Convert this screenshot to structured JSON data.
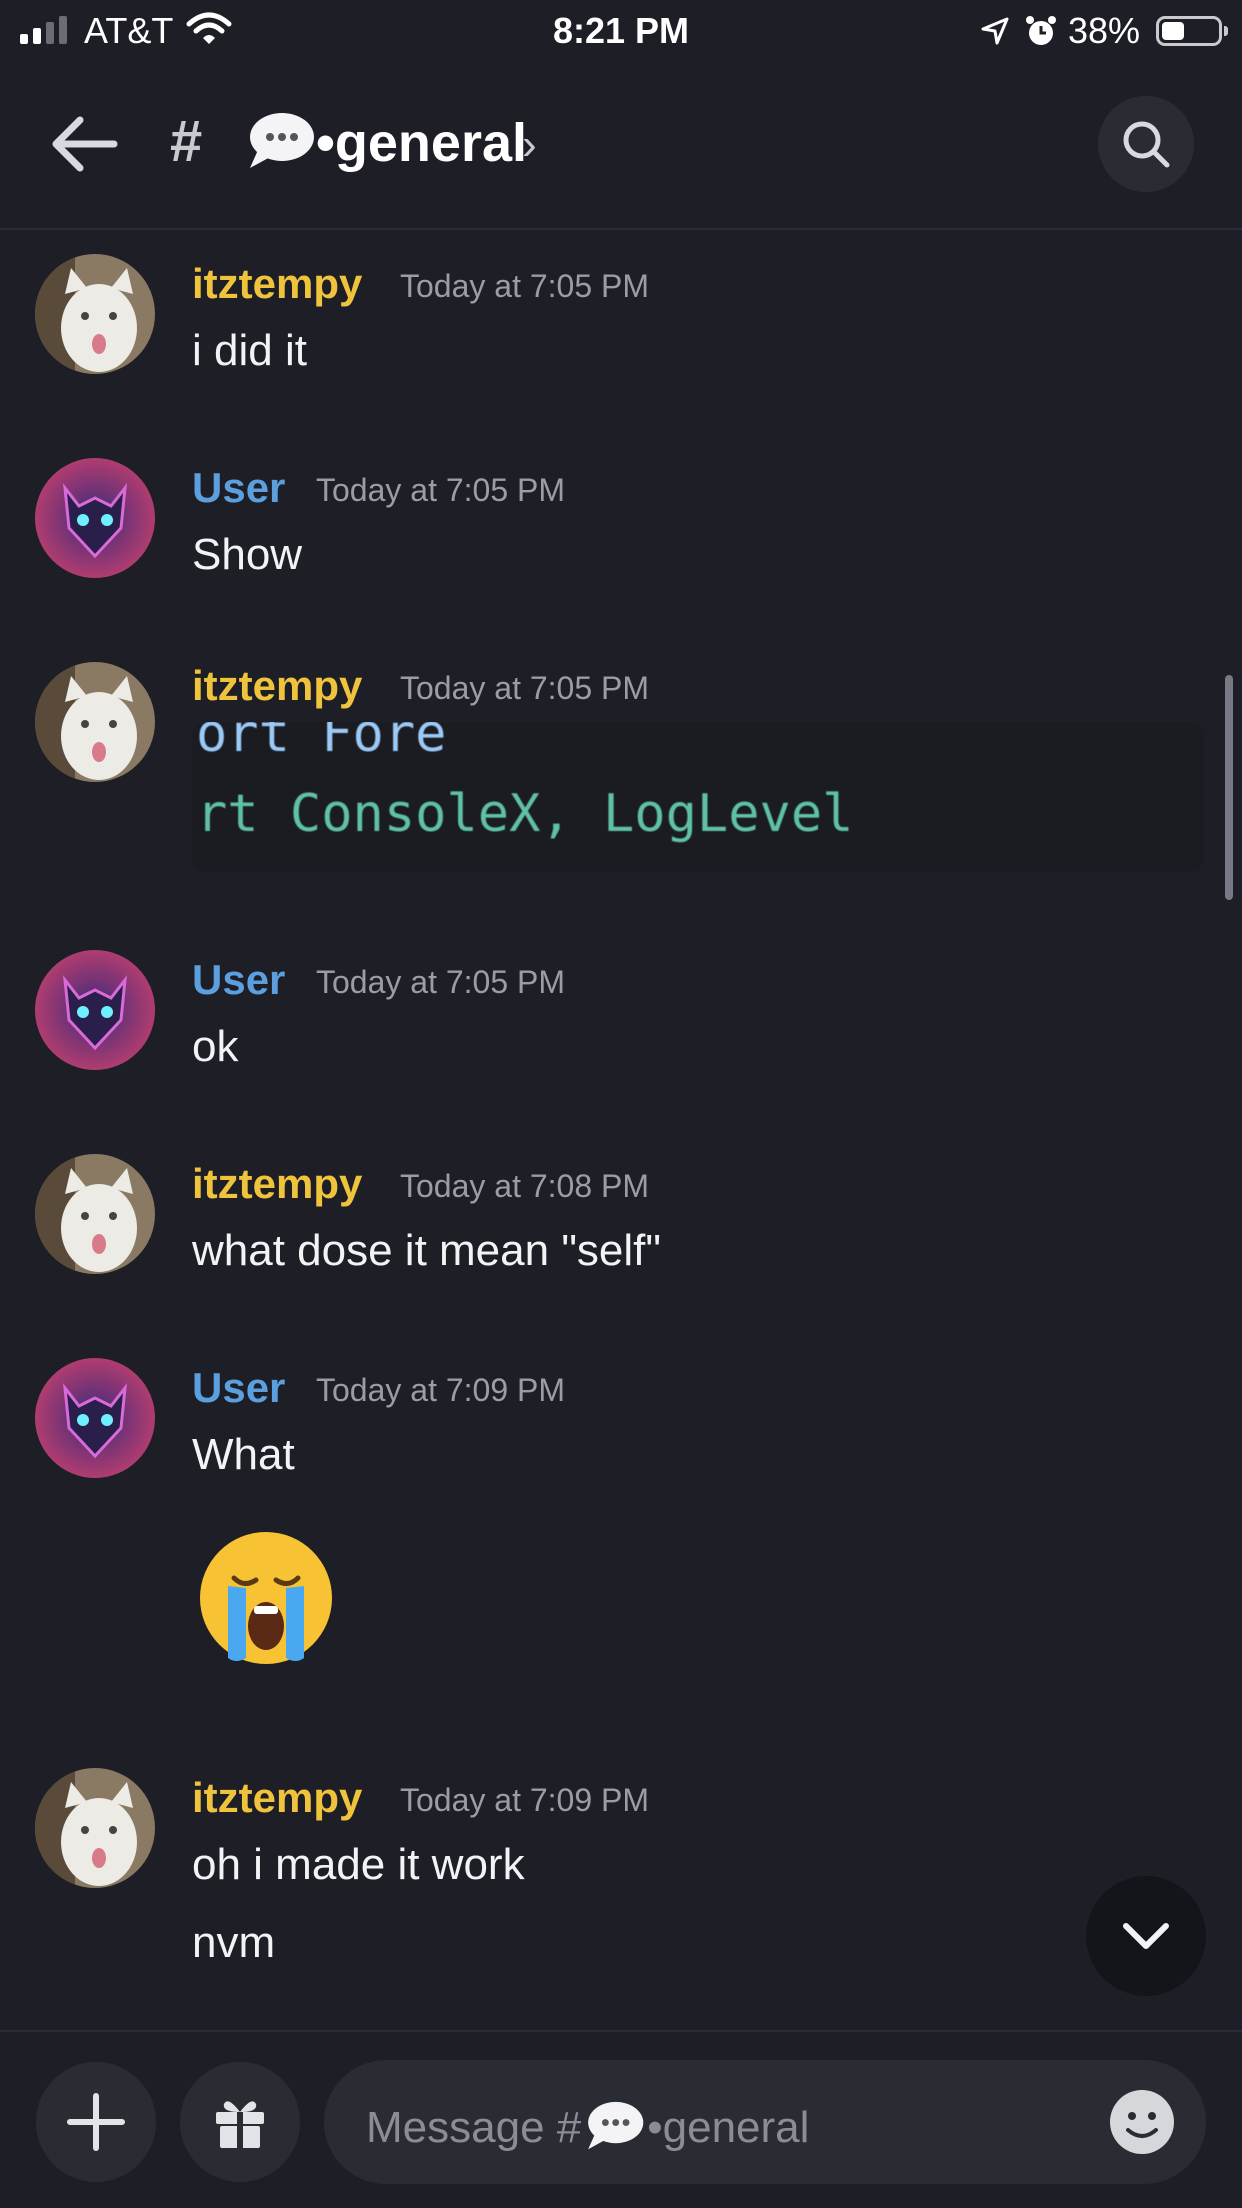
{
  "status_bar": {
    "carrier": "AT&T",
    "time": "8:21 PM",
    "battery": "38%"
  },
  "header": {
    "hash": "#",
    "channel_name": "•general",
    "chevron": "›"
  },
  "messages": [
    {
      "author": "itztempy",
      "timestamp": "Today at 7:05 PM",
      "lines": [
        "i did it"
      ]
    },
    {
      "author": "User",
      "timestamp": "Today at 7:05 PM",
      "lines": [
        "Show"
      ]
    },
    {
      "author": "itztempy",
      "timestamp": "Today at 7:05 PM",
      "code": [
        "ort Fore",
        "rt ConsoleX, LogLevel"
      ]
    },
    {
      "author": "User",
      "timestamp": "Today at 7:05 PM",
      "lines": [
        "ok"
      ]
    },
    {
      "author": "itztempy",
      "timestamp": "Today at 7:08 PM",
      "lines": [
        "what dose it mean \"self\""
      ]
    },
    {
      "author": "User",
      "timestamp": "Today at 7:09 PM",
      "lines": [
        "What"
      ]
    },
    {
      "author": "itztempy",
      "timestamp": "Today at 7:09 PM",
      "lines": [
        "oh i made it work",
        "nvm"
      ]
    }
  ],
  "composer": {
    "placeholder_prefix": "Message #",
    "placeholder_suffix": "•general"
  },
  "colors": {
    "background": "#1e1f26",
    "author_yellow": "#f0c33c",
    "author_blue": "#5b9fdf"
  }
}
